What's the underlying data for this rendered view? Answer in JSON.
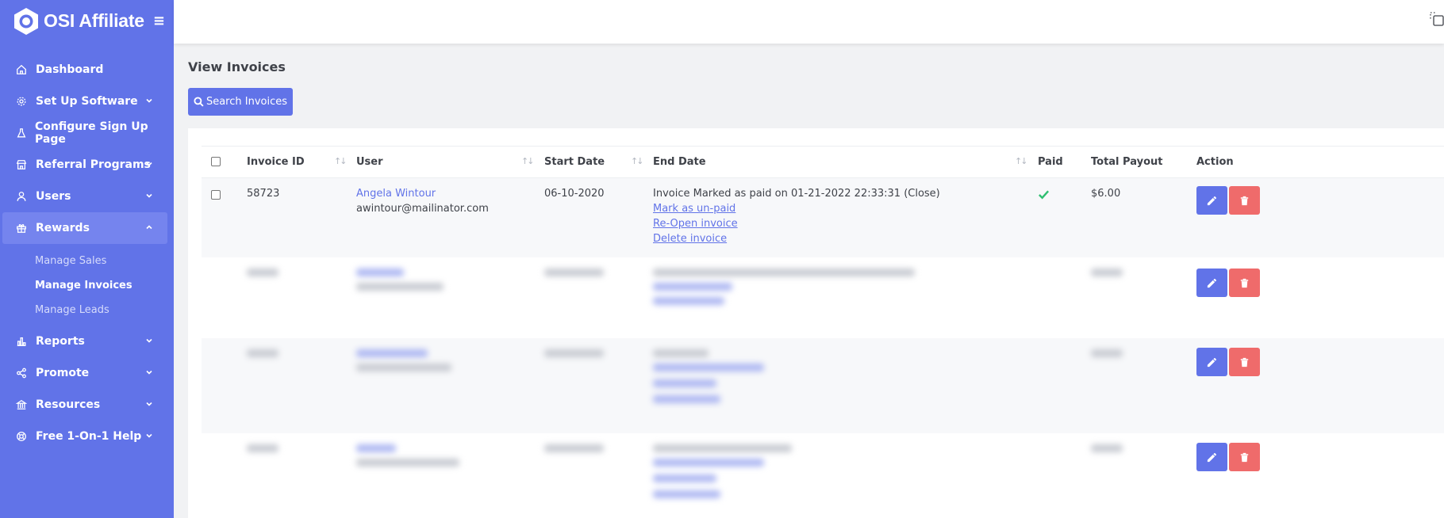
{
  "app": {
    "name": "OSI Affiliate"
  },
  "sidebar": {
    "items": [
      {
        "label": "Dashboard",
        "icon": "home-icon"
      },
      {
        "label": "Set Up Software",
        "icon": "gear-icon"
      },
      {
        "label": "Configure Sign Up Page",
        "icon": "flask-icon"
      },
      {
        "label": "Referral Programs",
        "icon": "store-icon"
      },
      {
        "label": "Users",
        "icon": "user-icon"
      },
      {
        "label": "Rewards",
        "icon": "gift-icon"
      },
      {
        "label": "Reports",
        "icon": "bar-chart-icon"
      },
      {
        "label": "Promote",
        "icon": "share-icon"
      },
      {
        "label": "Resources",
        "icon": "bank-icon"
      },
      {
        "label": "Free 1-On-1 Help",
        "icon": "lifebuoy-icon"
      }
    ],
    "rewards_sub": [
      {
        "label": "Manage Sales"
      },
      {
        "label": "Manage Invoices"
      },
      {
        "label": "Manage Leads"
      }
    ]
  },
  "page": {
    "title": "View Invoices",
    "search_button": "Search Invoices"
  },
  "table": {
    "columns": [
      "Invoice ID",
      "User",
      "Start Date",
      "End Date",
      "Paid",
      "Total Payout",
      "Action"
    ],
    "rows": [
      {
        "invoice_id": "58723",
        "user_name": "Angela Wintour",
        "user_email": "awintour@mailinator.com",
        "start_date": "06-10-2020",
        "end_date_text": "Invoice Marked as paid on 01-21-2022 22:33:31 (Close)",
        "actions": [
          "Mark as un-paid",
          "Re-Open invoice",
          "Delete invoice"
        ],
        "paid": true,
        "total_payout": "$6.00"
      }
    ]
  },
  "colors": {
    "sidebar": "#6173e8",
    "primary": "#6173e8",
    "danger": "#ef6b6b",
    "paid_check": "#2fbf71"
  }
}
